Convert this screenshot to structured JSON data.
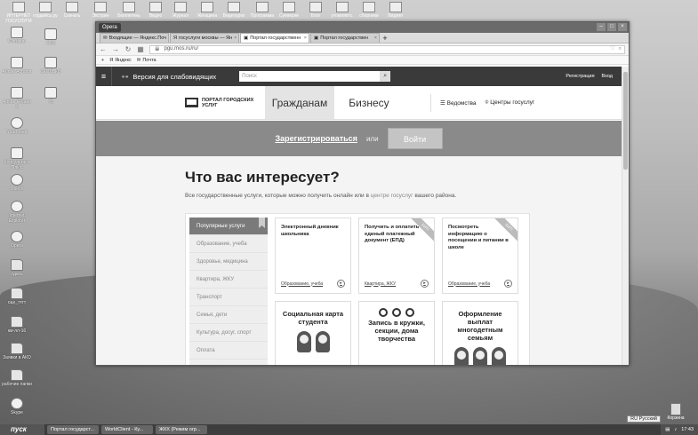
{
  "desktop": {
    "top_icons": [
      "ИНТЕРНЕТ ГОСУСЛУГИ",
      "гордийсь.ру",
      "Скачать",
      "Экстрин",
      "Бюллетень",
      "Видео",
      "Журнал",
      "Женщина",
      "Видеоурок",
      "Программа",
      "Суеверие",
      "Блог",
      "утомляетс.",
      "сборники",
      "Виджет"
    ],
    "left_icons": [
      "Wordstar",
      "ЖКХ",
      "Adobe Acrobat",
      "СКОЛЬКО",
      "Adobe Reader X",
      "78",
      "YCEmbed",
      "Консультант Плюс",
      "Moloto",
      "Internet Explorer",
      "Opera",
      "сдать",
      "оцe_тттт",
      "км-лл-16",
      "Заявки в АКО",
      "рабочие папки",
      "Skype"
    ],
    "recycle_label": "Корзина",
    "taskbar": {
      "start_label": "пуск",
      "buttons": [
        "Портал государст...",
        "WorldClient - Ку...",
        "ЖКХ (Режим огр..."
      ],
      "language": "RU Русский",
      "clock": "17:43"
    }
  },
  "browser": {
    "badge": "Opera",
    "tabs": [
      {
        "label": "Входящие — Яндекс.Поч"
      },
      {
        "label": "госуслуги москвы — Ян"
      },
      {
        "label": "Портал государственн"
      },
      {
        "label": "Портал государствен"
      }
    ],
    "url": "pgu.mos.ru/ru/",
    "bookmarks": [
      "Яндекс",
      "Почта"
    ]
  },
  "site": {
    "accessible_label": "Версия для слабовидящих",
    "search_placeholder": "Поиск",
    "top_links": [
      "Регистрация",
      "Вход"
    ],
    "logo_text": "ПОРТАЛ ГОРОДСКИХ УСЛУГ",
    "nav": {
      "citizens": "Гражданам",
      "business": "Бизнесу",
      "departments": "Ведомства",
      "centers": "Центры госуслуг"
    },
    "hero": {
      "register": "Зарегистрироваться",
      "or": "или",
      "login": "Войти"
    },
    "heading": "Что вас интересует?",
    "subtitle_before": "Все государственные услуги, которые можно получить онлайн или в",
    "subtitle_link": "центре госуслуг",
    "subtitle_after": "вашего района.",
    "side_menu": [
      "Популярные услуги",
      "Образование, учеба",
      "Здоровье, медицина",
      "Квартира, ЖКУ",
      "Транспорт",
      "Семья, дети",
      "Культура, досуг, спорт",
      "Оплата"
    ],
    "cards": [
      {
        "title": "Электронный дневник школьника",
        "ribbon": "",
        "category": "Образование, учеба"
      },
      {
        "title": "Получить и оплатить единый платежный документ (ЕПД)",
        "ribbon": "ХИТ!",
        "category": "Квартира, ЖКУ"
      },
      {
        "title": "Посмотреть информацию о посещении и питании в школе",
        "ribbon": "ХИТ!",
        "category": "Образование, учеба"
      },
      {
        "title": "Социальная карта студента",
        "ribbon": "",
        "category": ""
      },
      {
        "title": "Запись в кружки, секции, дома творчества",
        "ribbon": "",
        "category": ""
      },
      {
        "title": "Оформление выплат многодетным семьям",
        "ribbon": "",
        "category": ""
      }
    ]
  }
}
